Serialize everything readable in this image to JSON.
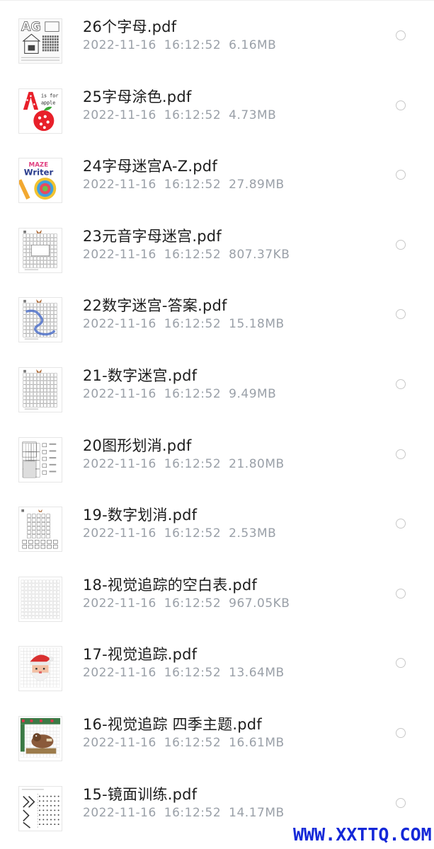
{
  "files": [
    {
      "name": "26个字母.pdf",
      "date": "2022-11-16",
      "time": "16:12:52",
      "size": "6.16MB",
      "thumb": "letters-icon"
    },
    {
      "name": "25字母涂色.pdf",
      "date": "2022-11-16",
      "time": "16:12:52",
      "size": "4.73MB",
      "thumb": "apple-letter-icon",
      "thumb_text": {
        "line1": "is for",
        "line2": "apple"
      }
    },
    {
      "name": "24字母迷宫A-Z.pdf",
      "date": "2022-11-16",
      "time": "16:12:52",
      "size": "27.89MB",
      "thumb": "maze-writer-icon",
      "thumb_text": {
        "line1": "MAZE",
        "line2": "Writer"
      }
    },
    {
      "name": "23元音字母迷宫.pdf",
      "date": "2022-11-16",
      "time": "16:12:52",
      "size": "807.37KB",
      "thumb": "maze-grid-icon"
    },
    {
      "name": "22数字迷宫-答案.pdf",
      "date": "2022-11-16",
      "time": "16:12:52",
      "size": "15.18MB",
      "thumb": "maze-answer-icon"
    },
    {
      "name": "21-数字迷宫.pdf",
      "date": "2022-11-16",
      "time": "16:12:52",
      "size": "9.49MB",
      "thumb": "number-maze-icon"
    },
    {
      "name": "20图形划消.pdf",
      "date": "2022-11-16",
      "time": "16:12:52",
      "size": "21.80MB",
      "thumb": "shape-cancel-icon"
    },
    {
      "name": "19-数字划消.pdf",
      "date": "2022-11-16",
      "time": "16:12:52",
      "size": "2.53MB",
      "thumb": "number-cancel-icon"
    },
    {
      "name": "18-视觉追踪的空白表.pdf",
      "date": "2022-11-16",
      "time": "16:12:52",
      "size": "967.05KB",
      "thumb": "blank-grid-icon"
    },
    {
      "name": "17-视觉追踪.pdf",
      "date": "2022-11-16",
      "time": "16:12:52",
      "size": "13.64MB",
      "thumb": "santa-pixel-icon"
    },
    {
      "name": "16-视觉追踪 四季主题.pdf",
      "date": "2022-11-16",
      "time": "16:12:52",
      "size": "16.61MB",
      "thumb": "bird-pixel-icon"
    },
    {
      "name": "15-镜面训练.pdf",
      "date": "2022-11-16",
      "time": "16:12:52",
      "size": "14.17MB",
      "thumb": "mirror-dots-icon"
    }
  ],
  "watermark": "WWW.XXTTQ.COM"
}
